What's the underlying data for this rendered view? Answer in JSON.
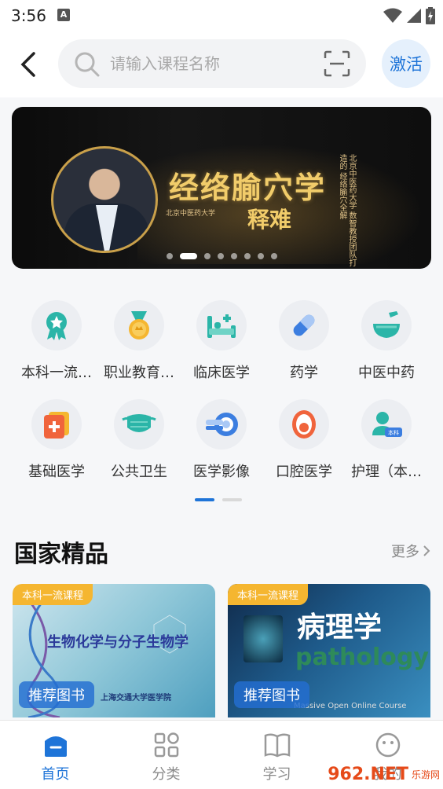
{
  "status_bar": {
    "time": "3:56",
    "notif_letter": "A"
  },
  "header": {
    "search_placeholder": "请输入课程名称",
    "activate_label": "激活"
  },
  "banner": {
    "title": "经络腧穴学",
    "subtitle": "释难",
    "university": "北京中医药大学",
    "side_text": "北京中医药大学 数智教授团队打造的 经络腧穴全解",
    "dot_count": 8,
    "active_dot": 1
  },
  "categories": [
    [
      {
        "label": "本科一流…",
        "icon": "ribbon-medal-icon"
      },
      {
        "label": "职业教育…",
        "icon": "gold-medal-icon"
      },
      {
        "label": "临床医学",
        "icon": "hospital-bed-icon"
      },
      {
        "label": "药学",
        "icon": "capsule-icon"
      },
      {
        "label": "中医中药",
        "icon": "mortar-pestle-icon"
      }
    ],
    [
      {
        "label": "基础医学",
        "icon": "first-aid-kit-icon"
      },
      {
        "label": "公共卫生",
        "icon": "face-mask-icon"
      },
      {
        "label": "医学影像",
        "icon": "scanner-icon"
      },
      {
        "label": "口腔医学",
        "icon": "mouth-icon"
      },
      {
        "label": "护理（本…",
        "icon": "nurse-icon",
        "badge": "本科"
      }
    ]
  ],
  "section": {
    "title": "国家精品",
    "more_label": "更多"
  },
  "cards": [
    {
      "tag": "本科一流课程",
      "course": "生物化学与分子生物学",
      "university": "上海交通大学医学院",
      "button": "推荐图书"
    },
    {
      "tag": "本科一流课程",
      "course": "病理学",
      "english": "pathology",
      "footer": "Massive Open Online Course",
      "button": "推荐图书"
    }
  ],
  "tabbar": [
    {
      "label": "首页",
      "icon": "home-icon",
      "active": true
    },
    {
      "label": "分类",
      "icon": "category-grid-icon",
      "active": false
    },
    {
      "label": "学习",
      "icon": "book-icon",
      "active": false
    },
    {
      "label": "我的",
      "icon": "smiley-icon",
      "active": false
    }
  ],
  "watermark": {
    "main": "962.NET",
    "sub": "乐游网"
  },
  "colors": {
    "accent": "#1e74d8",
    "teal": "#2bb5a8",
    "tag": "#f5b630"
  }
}
